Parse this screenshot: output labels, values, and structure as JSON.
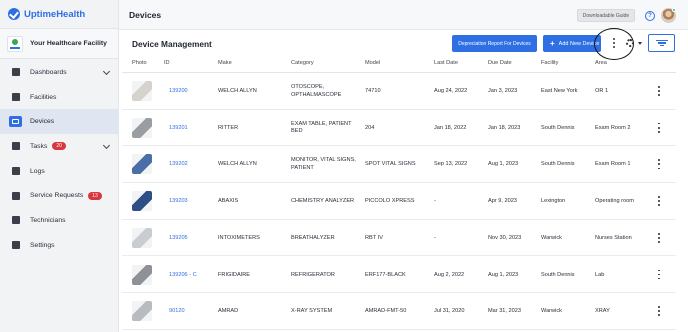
{
  "app": {
    "brand": "UptimeHealth",
    "facility": "Your Healthcare Facility"
  },
  "nav": [
    {
      "label": "Dashboards",
      "icon": "home-icon",
      "chevron": true
    },
    {
      "label": "Facilities",
      "icon": "building-icon"
    },
    {
      "label": "Devices",
      "icon": "devices-icon",
      "active": true
    },
    {
      "label": "Tasks",
      "icon": "tasks-icon",
      "badge": "20",
      "chevron": true
    },
    {
      "label": "Logs",
      "icon": "logs-icon"
    },
    {
      "label": "Service Requests",
      "icon": "clipboard-icon",
      "badge": "13"
    },
    {
      "label": "Technicians",
      "icon": "people-icon"
    },
    {
      "label": "Settings",
      "icon": "gear-icon"
    }
  ],
  "header": {
    "title": "Devices",
    "guide_label": "Downloadable Guide",
    "help": "?"
  },
  "main": {
    "title": "Device Management",
    "depreciation_label": "Depreciation Report For Devices",
    "add_label": "Add New Device",
    "add_plus": "+"
  },
  "table": {
    "columns": [
      "Photo",
      "ID",
      "Make",
      "Category",
      "Model",
      "Last Date",
      "Due Date",
      "Facility",
      "Area"
    ],
    "rows": [
      {
        "id": "139200",
        "make": "WELCH ALLYN",
        "category": [
          "OTOSCOPE,",
          "OPTHALMASCOPE"
        ],
        "model": "74710",
        "last": "Aug 24, 2022",
        "due": "Jan 3, 2023",
        "facility": "East New York",
        "area": "OR 1",
        "photo_color": "#d6d2cc"
      },
      {
        "id": "139201",
        "make": "RITTER",
        "category": [
          "EXAM TABLE, PATIENT",
          "BED"
        ],
        "model": "204",
        "last": "Jan 18, 2022",
        "due": "Jan 18, 2023",
        "facility": "South Dennis",
        "area": "Exam Room 2",
        "photo_color": "#9a9ea3"
      },
      {
        "id": "139202",
        "make": "WELCH ALLYN",
        "category": [
          "MONITOR, VITAL SIGNS,",
          "PATIENT"
        ],
        "model": "SPOT VITAL SIGNS",
        "last": "Sep 13, 2022",
        "due": "Aug 1, 2023",
        "facility": "South Dennis",
        "area": "Exam Room 1",
        "photo_color": "#4a6fa8"
      },
      {
        "id": "139203",
        "make": "ABAXIS",
        "category": [
          "CHEMISTRY ANALYZER"
        ],
        "model": "PICCOLO XPRESS",
        "last": "-",
        "due": "Apr 9, 2023",
        "facility": "Lexington",
        "area": "Operating room",
        "photo_color": "#2d4f86"
      },
      {
        "id": "139205",
        "make": "INTOXIMETERS",
        "category": [
          "BREATHALYZER"
        ],
        "model": "RBT IV",
        "last": "-",
        "due": "Nov 30, 2023",
        "facility": "Warwick",
        "area": "Nurses Station",
        "photo_color": "#c9ccd1"
      },
      {
        "id": "139206 - C",
        "make": "FRIGIDAIRE",
        "category": [
          "REFRIGERATOR"
        ],
        "model": "ERF177-BLACK",
        "last": "Aug 2, 2022",
        "due": "Aug 1, 2023",
        "facility": "South Dennis",
        "area": "Lab",
        "photo_color": "#8e9297"
      },
      {
        "id": "90120",
        "make": "AMRAD",
        "category": [
          "X-RAY SYSTEM"
        ],
        "model": "AMRAD-FMT-50",
        "last": "Jul 31, 2020",
        "due": "Mar 31, 2023",
        "facility": "Warwick",
        "area": "XRAY",
        "photo_color": "#b8bcc1"
      }
    ]
  }
}
